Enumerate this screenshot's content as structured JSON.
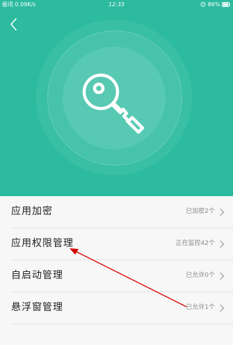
{
  "statusbar": {
    "left": "振讯 0.09K/s",
    "time": "12:33",
    "battery": "86%"
  },
  "icons": {
    "back": "back-arrow-icon",
    "key": "key-icon",
    "chevron": "chevron-right-icon",
    "wifi": "wifi-icon",
    "alarm": "alarm-icon",
    "battery": "battery-icon"
  },
  "colors": {
    "header_bg": "#2dbb9f",
    "annotation_arrow": "#d40000"
  },
  "menu": {
    "items": [
      {
        "label": "应用加密",
        "status": "已加密2个"
      },
      {
        "label": "应用权限管理",
        "status": "正在监控42个"
      },
      {
        "label": "自启动管理",
        "status": "已允许0个"
      },
      {
        "label": "悬浮窗管理",
        "status": "已允许1个"
      }
    ]
  }
}
